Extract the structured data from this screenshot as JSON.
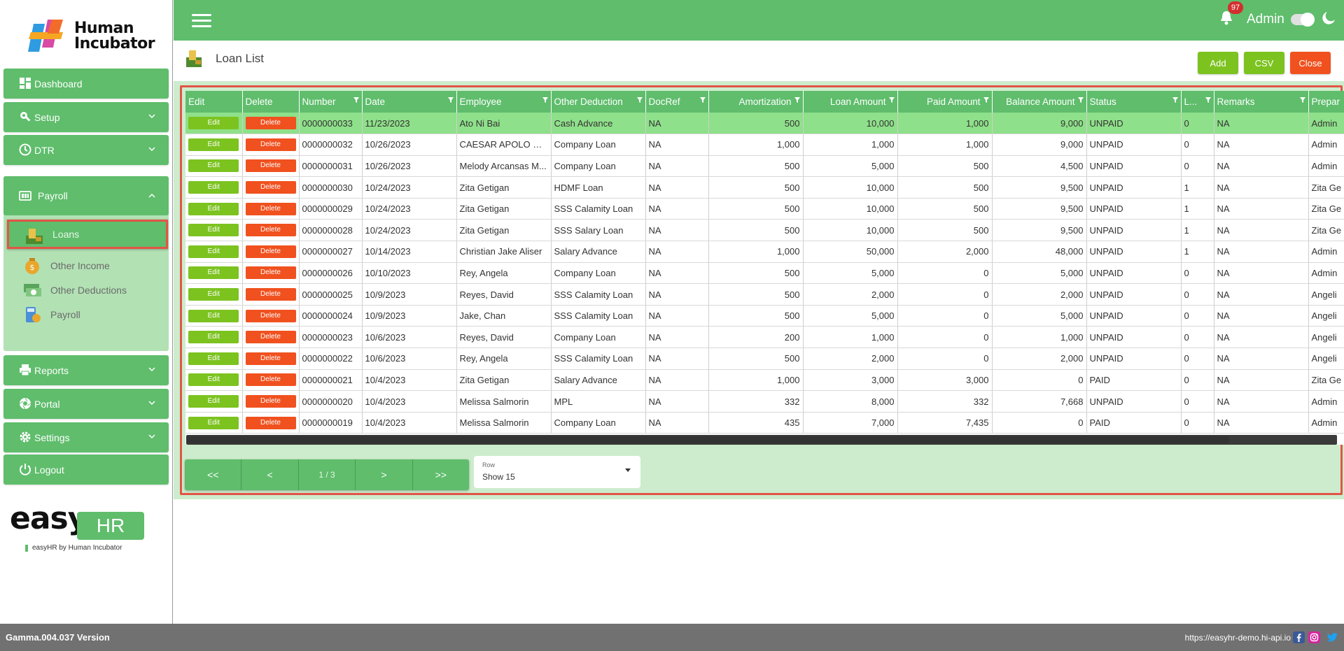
{
  "sidebar": {
    "brand": [
      "Human",
      "Incubator"
    ],
    "nav": [
      {
        "label": "Dashboard",
        "icon": "dashboard-icon"
      },
      {
        "label": "Setup",
        "icon": "wrench-icon"
      },
      {
        "label": "DTR",
        "icon": "clock-icon"
      }
    ],
    "payroll": {
      "label": "Payroll",
      "icon": "payroll-icon",
      "items": [
        {
          "label": "Loans",
          "icon": "money-bag-icon",
          "active": true
        },
        {
          "label": "Other Income",
          "icon": "coin-bag-icon"
        },
        {
          "label": "Other Deductions",
          "icon": "cash-icon"
        },
        {
          "label": "Payroll",
          "icon": "calculator-icon"
        }
      ]
    },
    "nav_bottom": [
      {
        "label": "Reports",
        "icon": "printer-icon"
      },
      {
        "label": "Portal",
        "icon": "aperture-icon"
      },
      {
        "label": "Settings",
        "icon": "gear-icon"
      },
      {
        "label": "Logout",
        "icon": "power-icon"
      }
    ],
    "footer_logo": {
      "easy": "easy",
      "hr": "HR",
      "tagline": "easyHR by Human Incubator"
    }
  },
  "topbar": {
    "notifications": "97",
    "user": "Admin"
  },
  "page": {
    "title": "Loan List",
    "add_label": "Add",
    "csv_label": "CSV",
    "close_label": "Close"
  },
  "table": {
    "columns": [
      "Edit",
      "Delete",
      "Number",
      "Date",
      "Employee",
      "Other Deduction",
      "DocRef",
      "Amortization",
      "Loan Amount",
      "Paid Amount",
      "Balance Amount",
      "Status",
      "L...",
      "Remarks",
      "Prepar"
    ],
    "edit_label": "Edit",
    "delete_label": "Delete",
    "rows": [
      [
        "0000000033",
        "11/23/2023",
        "Ato Ni Bai",
        "Cash Advance",
        "NA",
        "500",
        "10,000",
        "1,000",
        "9,000",
        "UNPAID",
        "0",
        "NA",
        "Admin"
      ],
      [
        "0000000032",
        "10/26/2023",
        "CAESAR APOLO DIT...",
        "Company Loan",
        "NA",
        "1,000",
        "1,000",
        "1,000",
        "9,000",
        "UNPAID",
        "0",
        "NA",
        "Admin"
      ],
      [
        "0000000031",
        "10/26/2023",
        "Melody Arcansas M...",
        "Company Loan",
        "NA",
        "500",
        "5,000",
        "500",
        "4,500",
        "UNPAID",
        "0",
        "NA",
        "Admin"
      ],
      [
        "0000000030",
        "10/24/2023",
        "Zita Getigan",
        "HDMF Loan",
        "NA",
        "500",
        "10,000",
        "500",
        "9,500",
        "UNPAID",
        "1",
        "NA",
        "Zita Ge"
      ],
      [
        "0000000029",
        "10/24/2023",
        "Zita Getigan",
        "SSS Calamity Loan",
        "NA",
        "500",
        "10,000",
        "500",
        "9,500",
        "UNPAID",
        "1",
        "NA",
        "Zita Ge"
      ],
      [
        "0000000028",
        "10/24/2023",
        "Zita Getigan",
        "SSS Salary Loan",
        "NA",
        "500",
        "10,000",
        "500",
        "9,500",
        "UNPAID",
        "1",
        "NA",
        "Zita Ge"
      ],
      [
        "0000000027",
        "10/14/2023",
        "Christian Jake Aliser",
        "Salary Advance",
        "NA",
        "1,000",
        "50,000",
        "2,000",
        "48,000",
        "UNPAID",
        "1",
        "NA",
        "Admin"
      ],
      [
        "0000000026",
        "10/10/2023",
        "Rey, Angela",
        "Company Loan",
        "NA",
        "500",
        "5,000",
        "0",
        "5,000",
        "UNPAID",
        "0",
        "NA",
        "Admin"
      ],
      [
        "0000000025",
        "10/9/2023",
        "Reyes, David",
        "SSS Calamity Loan",
        "NA",
        "500",
        "2,000",
        "0",
        "2,000",
        "UNPAID",
        "0",
        "NA",
        "Angeli"
      ],
      [
        "0000000024",
        "10/9/2023",
        "Jake, Chan",
        "SSS Calamity Loan",
        "NA",
        "500",
        "5,000",
        "0",
        "5,000",
        "UNPAID",
        "0",
        "NA",
        "Angeli"
      ],
      [
        "0000000023",
        "10/6/2023",
        "Reyes, David",
        "Company Loan",
        "NA",
        "200",
        "1,000",
        "0",
        "1,000",
        "UNPAID",
        "0",
        "NA",
        "Angeli"
      ],
      [
        "0000000022",
        "10/6/2023",
        "Rey, Angela",
        "SSS Calamity Loan",
        "NA",
        "500",
        "2,000",
        "0",
        "2,000",
        "UNPAID",
        "0",
        "NA",
        "Angeli"
      ],
      [
        "0000000021",
        "10/4/2023",
        "Zita Getigan",
        "Salary Advance",
        "NA",
        "1,000",
        "3,000",
        "3,000",
        "0",
        "PAID",
        "0",
        "NA",
        "Zita Ge"
      ],
      [
        "0000000020",
        "10/4/2023",
        "Melissa Salmorin",
        "MPL",
        "NA",
        "332",
        "8,000",
        "332",
        "7,668",
        "UNPAID",
        "0",
        "NA",
        "Admin"
      ],
      [
        "0000000019",
        "10/4/2023",
        "Melissa Salmorin",
        "Company Loan",
        "NA",
        "435",
        "7,000",
        "7,435",
        "0",
        "PAID",
        "0",
        "NA",
        "Admin"
      ]
    ]
  },
  "pagination": {
    "first": "<<",
    "prev": "<",
    "info": "1 / 3",
    "next": ">",
    "last": ">>",
    "rows_label": "Row",
    "rows_value": "Show 15"
  },
  "footer": {
    "version": "Gamma.004.037 Version",
    "url": "https://easyhr-demo.hi-api.io"
  },
  "colors": {
    "primary": "#5fbd6c",
    "light": "#cdeccd",
    "edit": "#7cc320",
    "delete": "#f0511f",
    "highlight": "#e25545"
  }
}
